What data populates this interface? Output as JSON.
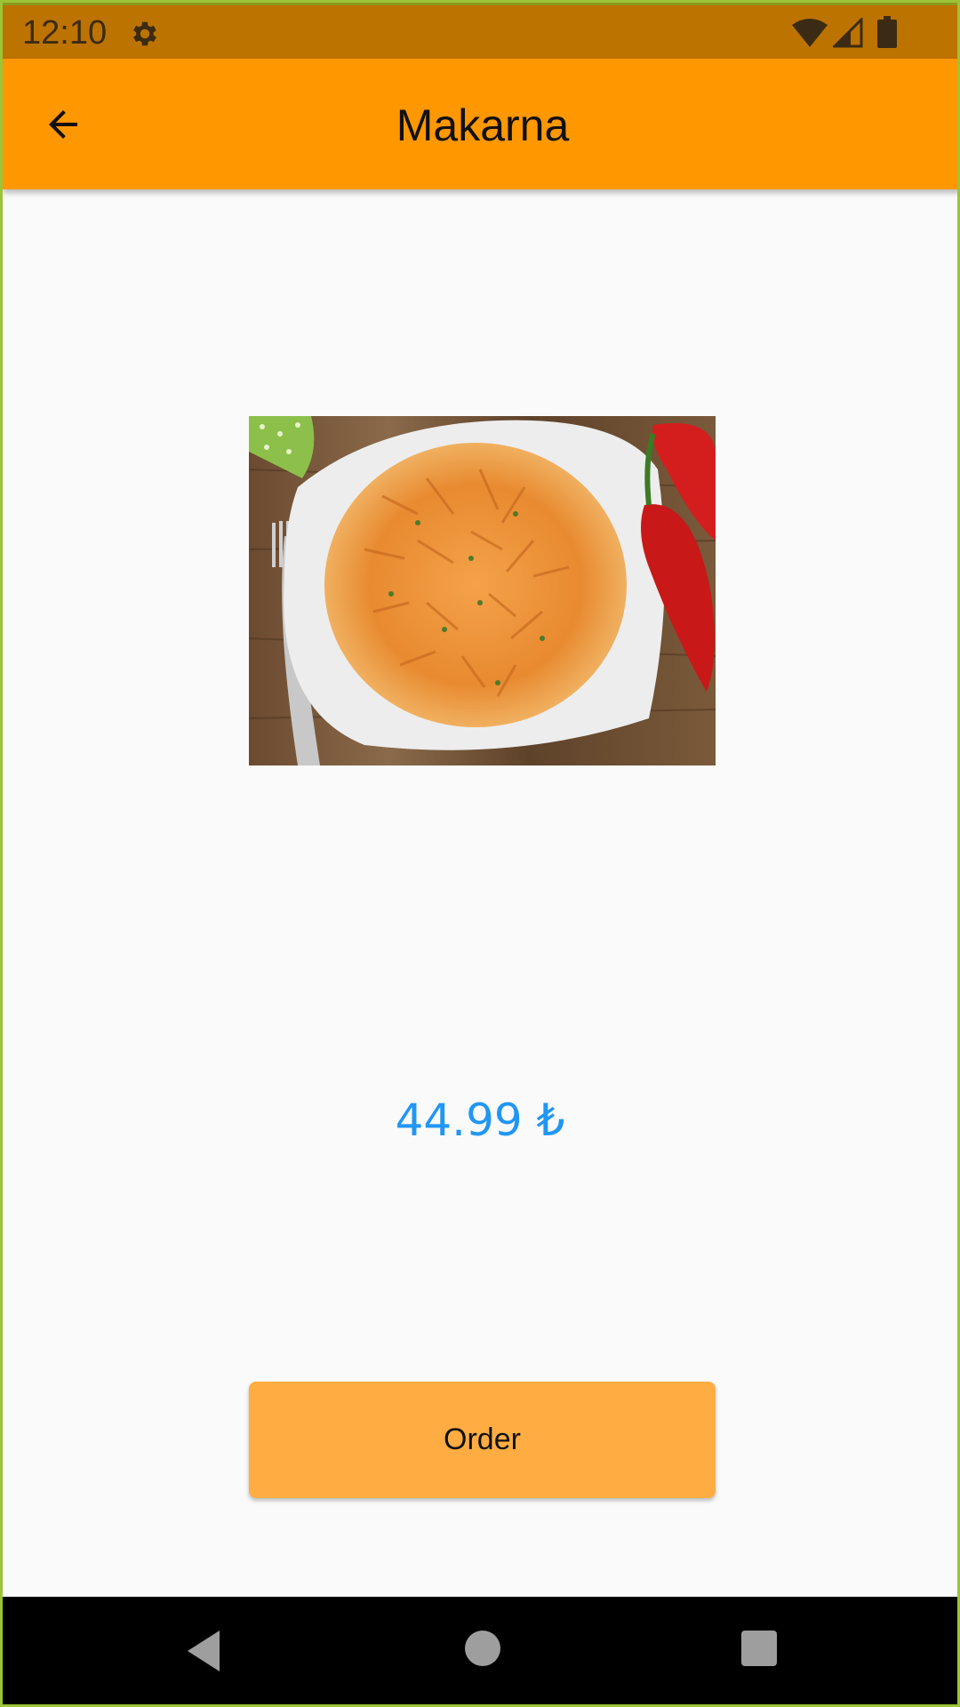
{
  "status_bar": {
    "time": "12:10",
    "icons": [
      "gear-icon",
      "wifi-icon",
      "signal-icon",
      "battery-icon"
    ]
  },
  "app_bar": {
    "title": "Makarna",
    "back_icon": "arrow-left-icon",
    "color": "#ff9800"
  },
  "product": {
    "image_alt": "penne pasta",
    "price": "44.99 ₺",
    "price_color": "#2196f3"
  },
  "order_button": {
    "label": "Order",
    "color": "#ffad42"
  },
  "nav_bar": {
    "icons": [
      "nav-back-icon",
      "nav-home-icon",
      "nav-recents-icon"
    ]
  }
}
